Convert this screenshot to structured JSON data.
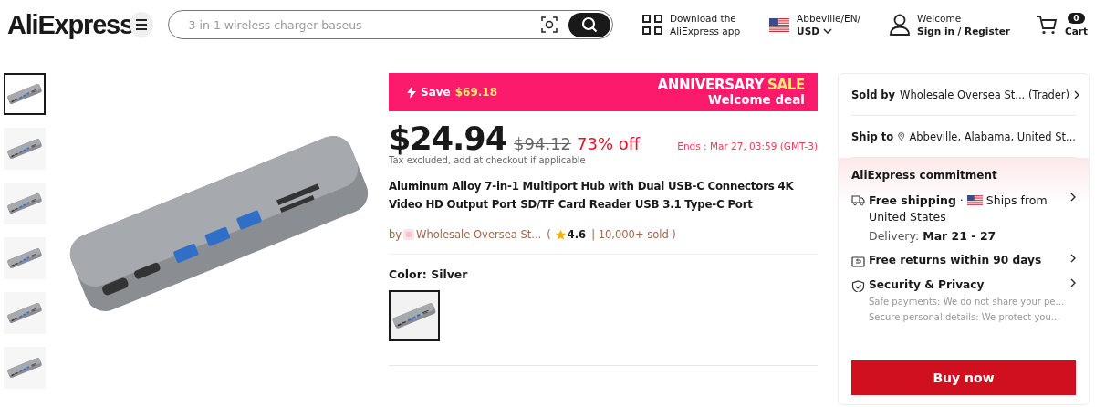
{
  "header": {
    "logo": "AliExpress",
    "search": {
      "placeholder": "3 in 1 wireless charger baseus"
    },
    "app_download": [
      "Download the",
      "AliExpress app"
    ],
    "locale": {
      "region": "Abbeville/EN/",
      "currency": "USD"
    },
    "account": {
      "greeting": "Welcome",
      "action": "Sign in / Register"
    },
    "cart": {
      "count": "0",
      "label": "Cart"
    }
  },
  "gallery": {
    "thumbnails": [
      {
        "selected": true
      },
      {
        "selected": false
      },
      {
        "selected": false
      },
      {
        "selected": false
      },
      {
        "selected": false
      },
      {
        "selected": false
      }
    ]
  },
  "promo": {
    "save_label": "Save",
    "save_amount": "$69.18",
    "sale_word": "ANNIVERSARY",
    "sale_highlight": "SALE",
    "deal": "Welcome deal"
  },
  "price": {
    "current": "$24.94",
    "original": "$94.12",
    "discount": "73% off",
    "ends": "Ends :  Mar 27, 03:59 (GMT-3)",
    "tax_note": "Tax excluded, add at checkout if applicable"
  },
  "title": "Aluminum Alloy 7-in-1 Multiport Hub with Dual USB-C Connectors 4K Video HD Output Port SD/TF Card Reader USB 3.1 Type-C Port",
  "store_line": {
    "by": "by",
    "store": "Wholesale Oversea St...",
    "open": "(",
    "rating": "4.6",
    "sold": "| 10,000+ sold )"
  },
  "color": {
    "label": "Color: Silver",
    "swatches": [
      {
        "selected": true
      }
    ]
  },
  "side_panel": {
    "sold_by": {
      "label": "Sold by",
      "value": "Wholesale Oversea St...  (Trader)"
    },
    "ship_to": {
      "label": "Ship to",
      "value": "Abbeville, Alabama, United St..."
    },
    "commitment": {
      "title": "AliExpress commitment",
      "items": [
        {
          "kind": "shipping",
          "title": "Free shipping",
          "separator": "·",
          "detail": "Ships from United States",
          "delivery_label": "Delivery:",
          "delivery_value": "Mar 21 - 27"
        },
        {
          "kind": "returns",
          "title": "Free returns within 90 days"
        },
        {
          "kind": "security",
          "title": "Security & Privacy",
          "lines": [
            "Safe payments: We do not share your pe...",
            "Secure personal details: We protect you..."
          ]
        }
      ]
    },
    "buy_button": "Buy now"
  }
}
